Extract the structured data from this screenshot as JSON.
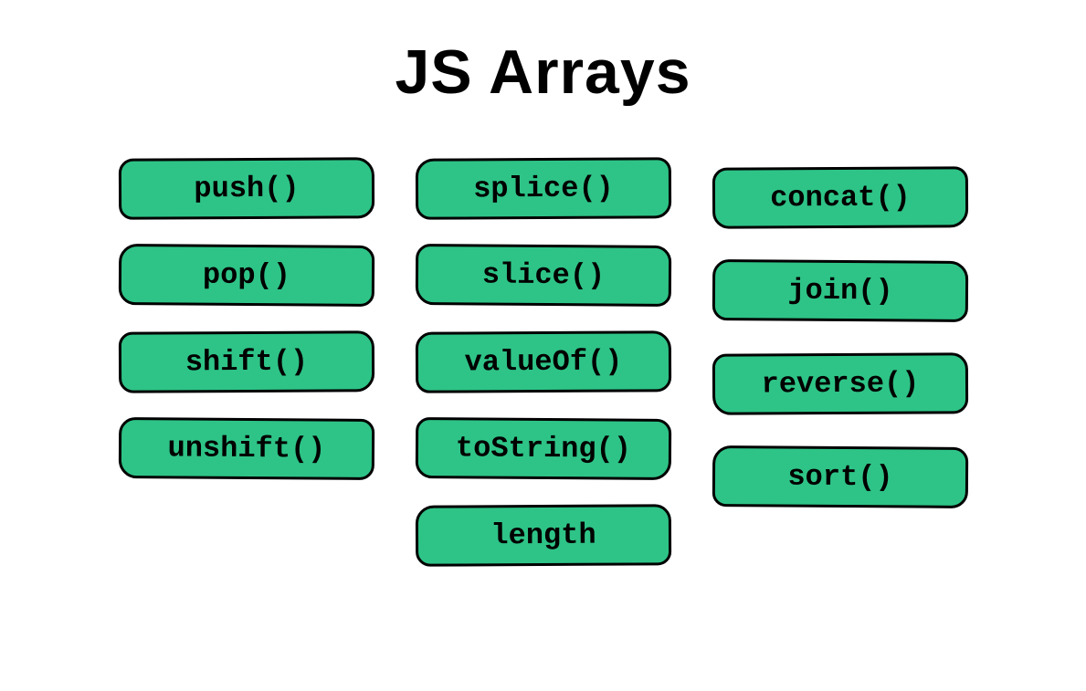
{
  "title": "JS Arrays",
  "columns": [
    {
      "items": [
        "push()",
        "pop()",
        "shift()",
        "unshift()"
      ]
    },
    {
      "items": [
        "splice()",
        "slice()",
        "valueOf()",
        "toString()",
        "length"
      ]
    },
    {
      "items": [
        "concat()",
        "join()",
        "reverse()",
        "sort()"
      ]
    }
  ],
  "colors": {
    "box_fill": "#2ec487",
    "box_border": "#000000",
    "text": "#000000",
    "background": "#ffffff"
  }
}
